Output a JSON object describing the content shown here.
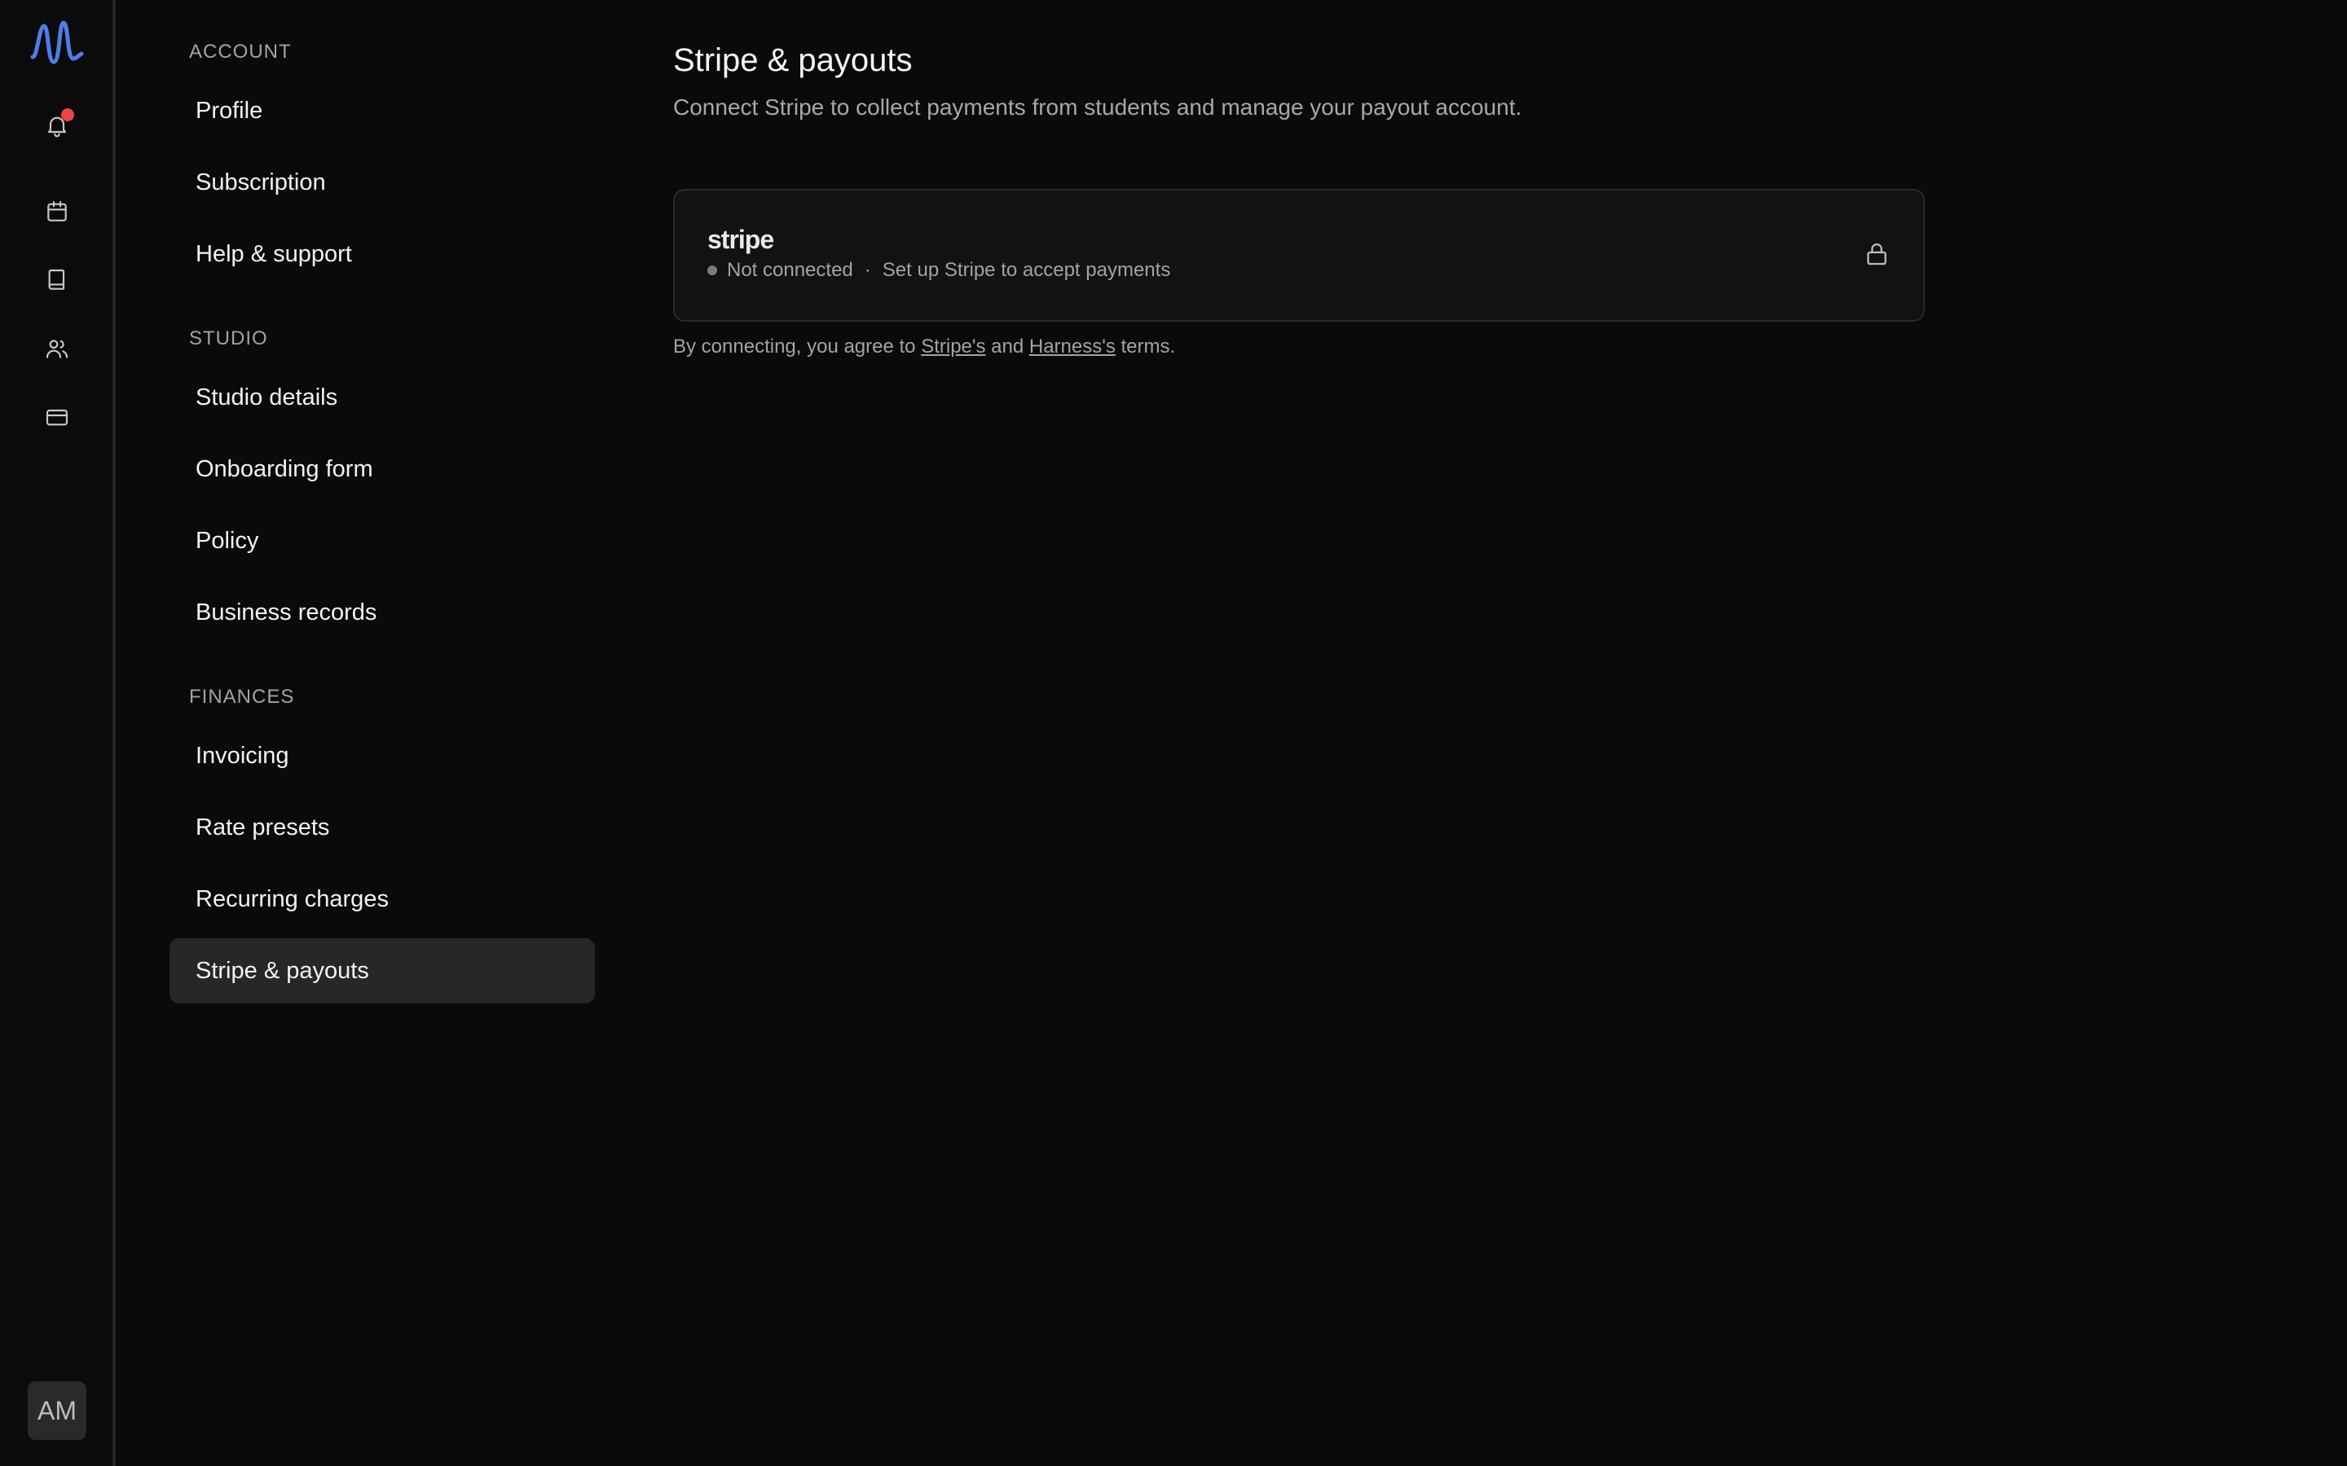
{
  "rail": {
    "avatar_initials": "AM",
    "icons": [
      "logo-icon",
      "bell-icon",
      "calendar-icon",
      "book-icon",
      "users-icon",
      "credit-card-icon"
    ]
  },
  "nav": {
    "sections": [
      {
        "title": "ACCOUNT",
        "items": [
          "Profile",
          "Subscription",
          "Help & support"
        ]
      },
      {
        "title": "STUDIO",
        "items": [
          "Studio details",
          "Onboarding form",
          "Policy",
          "Business records"
        ]
      },
      {
        "title": "FINANCES",
        "items": [
          "Invoicing",
          "Rate presets",
          "Recurring charges",
          "Stripe & payouts"
        ]
      }
    ],
    "active_item": "Stripe & payouts"
  },
  "main": {
    "title": "Stripe & payouts",
    "subtitle": "Connect Stripe to collect payments from students and manage your payout account.",
    "card": {
      "brand": "stripe",
      "status": "Not connected",
      "separator": "·",
      "description": "Set up Stripe to accept payments"
    },
    "terms": {
      "prefix": "By connecting, you agree to",
      "link1": "Stripe's",
      "middle": "and",
      "link2": "Harness's",
      "suffix": "terms."
    }
  },
  "colors": {
    "background": "#0a0a0a",
    "active_nav": "#272727",
    "notification": "#ef4444",
    "logo": "#4f7de6"
  }
}
